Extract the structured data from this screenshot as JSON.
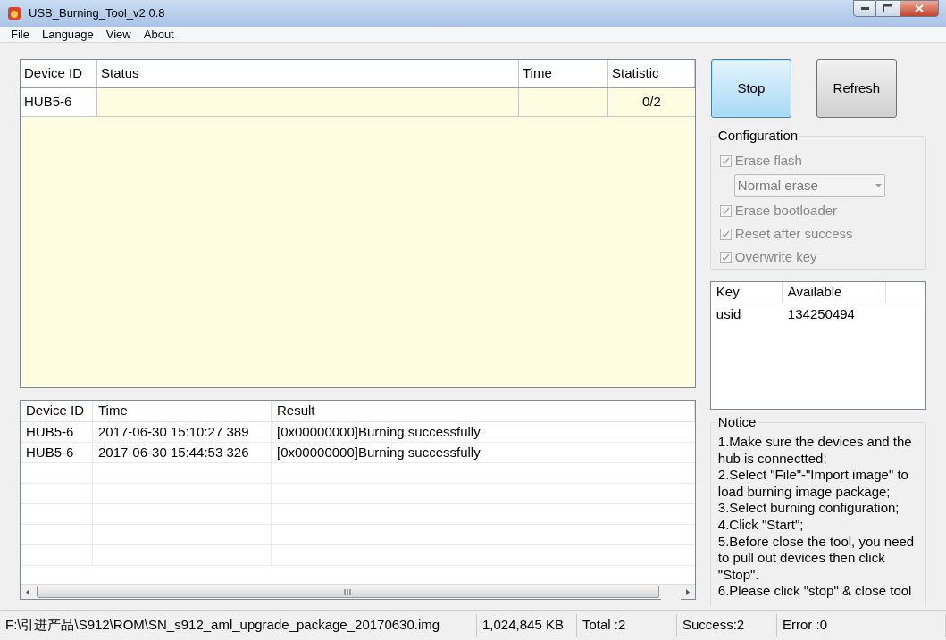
{
  "window": {
    "title": "USB_Burning_Tool_v2.0.8"
  },
  "menu": [
    "File",
    "Language",
    "View",
    "About"
  ],
  "devices": {
    "columns": [
      "Device ID",
      "Status",
      "Time",
      "Statistic"
    ],
    "rows": [
      {
        "device_id": "HUB5-6",
        "statistic": "0/2"
      }
    ]
  },
  "buttons": [
    {
      "label": "Stop",
      "focused": true
    },
    {
      "label": "Refresh",
      "focused": false
    }
  ],
  "configuration": {
    "title": "Configuration",
    "items": [
      {
        "kind": "checkbox",
        "label": "Erase flash",
        "checked": true,
        "disabled": true
      },
      {
        "kind": "dropdown",
        "value": "Normal erase",
        "disabled": true
      },
      {
        "kind": "checkbox",
        "label": "Erase bootloader",
        "checked": true,
        "disabled": true
      },
      {
        "kind": "checkbox",
        "label": "Reset after success",
        "checked": true,
        "disabled": true
      },
      {
        "kind": "checkbox",
        "label": "Overwrite key",
        "checked": true,
        "disabled": true
      }
    ]
  },
  "keys": {
    "columns": [
      "Key",
      "Available"
    ],
    "rows": [
      {
        "key": "usid",
        "available": "134250494"
      }
    ]
  },
  "log": {
    "columns": [
      "Device ID",
      "Time",
      "Result"
    ],
    "rows": [
      {
        "device_id": "HUB5-6",
        "time": "2017-06-30 15:10:27 389",
        "result": "[0x00000000]Burning successfully"
      },
      {
        "device_id": "HUB5-6",
        "time": "2017-06-30 15:44:53 326",
        "result": "[0x00000000]Burning successfully"
      }
    ]
  },
  "notice": {
    "title": "Notice",
    "lines": [
      "1.Make sure the devices and the hub is connectted;",
      "2.Select \"File\"-\"Import image\" to load burning image package;",
      "3.Select burning configuration;",
      "4.Click \"Start\";",
      "5.Before close the tool, you need to pull out devices then click \"Stop\".",
      "6.Please click \"stop\" & close tool"
    ]
  },
  "status_bar": [
    "F:\\引进产品\\S912\\ROM\\SN_s912_aml_upgrade_package_20170630.img",
    "1,024,845 KB",
    "Total :2",
    "Success:2",
    "Error :0"
  ]
}
